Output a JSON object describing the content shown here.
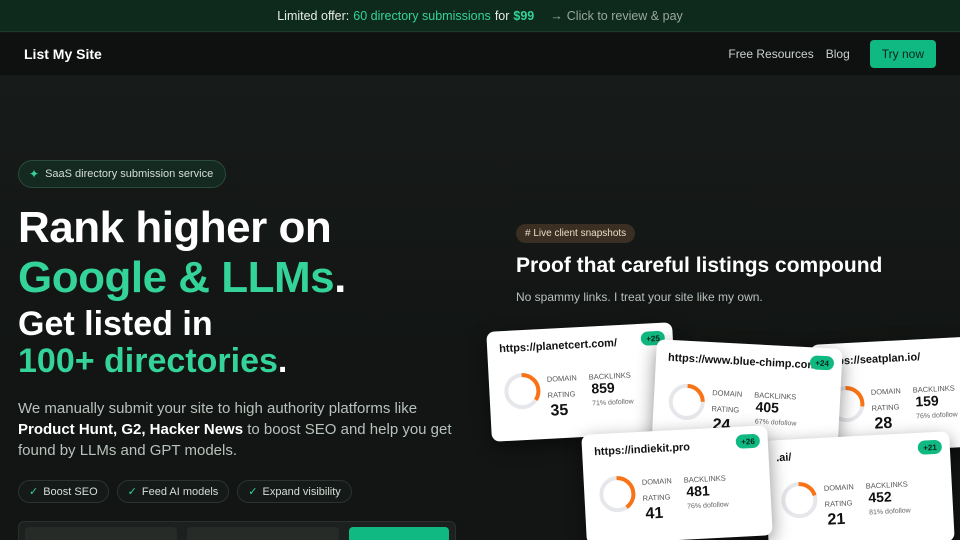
{
  "promo": {
    "prefix": "Limited offer:",
    "highlight": "60 directory submissions",
    "middle": "for",
    "price": "$99",
    "arrow": "→",
    "cta": "Click to review & pay"
  },
  "nav": {
    "brand": "List My Site",
    "links": [
      "Free Resources",
      "Blog"
    ],
    "try_label": "Try now"
  },
  "hero": {
    "badge": "SaaS directory submission service",
    "line1": "Rank higher on",
    "line2": "Google & LLMs",
    "line3": "Get listed in",
    "line4": "100+ directories",
    "period": ".",
    "desc_a": "We manually submit your site to high authority platforms like ",
    "desc_bold": "Product Hunt, G2, Hacker News",
    "desc_b": " to boost SEO and help you get found by LLMs and GPT models.",
    "pills": [
      "Boost SEO",
      "Feed AI models",
      "Expand visibility"
    ]
  },
  "proof": {
    "tag": "# Live client snapshots",
    "title": "Proof that careful listings compound",
    "subtitle": "No spammy links. I treat your site like my own.",
    "cards": [
      {
        "url": "https://planetcert.com/",
        "plus": "+25",
        "domain_label": "DOMAIN",
        "rating_label": "RATING",
        "rating": "35",
        "backlinks_label": "BACKLINKS",
        "backlinks": "859",
        "dofollow": "71% dofollow",
        "ring": 0.35
      },
      {
        "url": "https://www.blue-chimp.com/",
        "plus": "+24",
        "domain_label": "DOMAIN",
        "rating_label": "RATING",
        "rating": "24",
        "backlinks_label": "BACKLINKS",
        "backlinks": "405",
        "dofollow": "67% dofollow",
        "ring": 0.24
      },
      {
        "url": "https://seatplan.io/",
        "plus": "",
        "domain_label": "DOMAIN",
        "rating_label": "RATING",
        "rating": "28",
        "backlinks_label": "BACKLINKS",
        "backlinks": "159",
        "dofollow": "76% dofollow",
        "ring": 0.28
      },
      {
        "url": "https://indiekit.pro",
        "plus": "+26",
        "domain_label": "DOMAIN",
        "rating_label": "RATING",
        "rating": "41",
        "backlinks_label": "BACKLINKS",
        "backlinks": "481",
        "dofollow": "76% dofollow",
        "ring": 0.41
      },
      {
        "url": ".ai/",
        "plus": "+21",
        "domain_label": "DOMAIN",
        "rating_label": "RATING",
        "rating": "21",
        "backlinks_label": "BACKLINKS",
        "backlinks": "452",
        "dofollow": "81% dofollow",
        "ring": 0.21
      }
    ]
  },
  "colors": {
    "accent": "#10b981",
    "ring": "#f97316"
  }
}
